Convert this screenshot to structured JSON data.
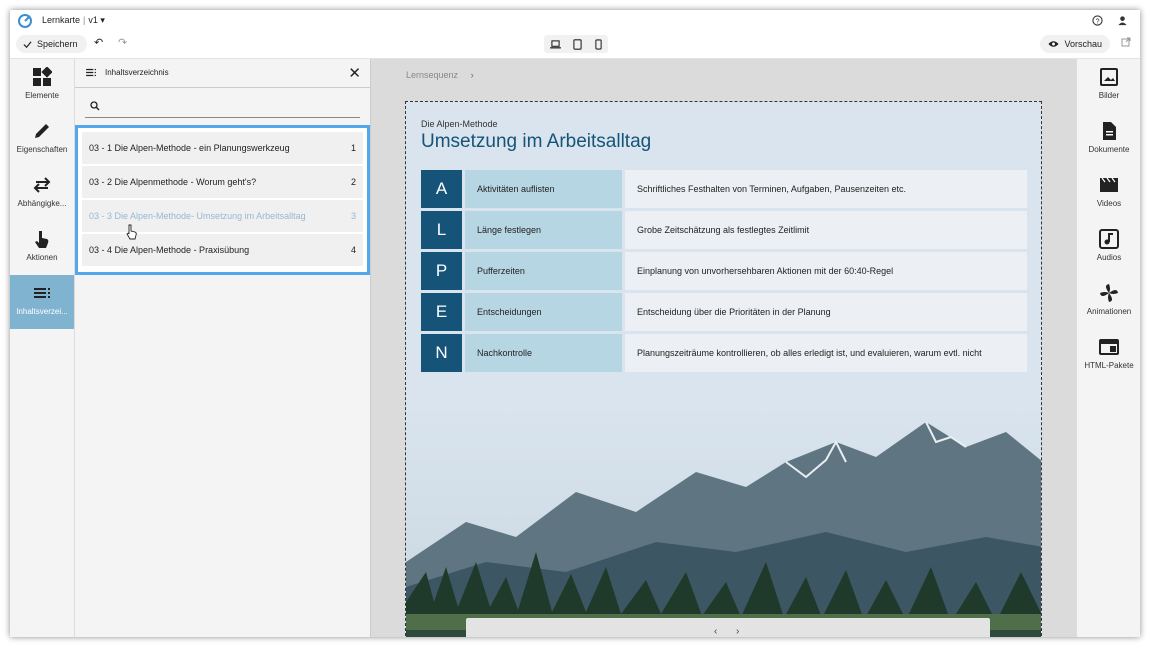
{
  "app": {
    "title": "Lernkarte",
    "version": "v1 ▾"
  },
  "toolbar": {
    "save_label": "Speichern",
    "preview_label": "Vorschau"
  },
  "left_rail": {
    "items": [
      {
        "label": "Elemente",
        "icon": "elements-icon"
      },
      {
        "label": "Eigenschaften",
        "icon": "pencil-icon"
      },
      {
        "label": "Abhängigke...",
        "icon": "swap-arrows-icon"
      },
      {
        "label": "Aktionen",
        "icon": "touch-hand-icon"
      },
      {
        "label": "Inhaltsverzei...",
        "icon": "toc-icon",
        "active": true
      }
    ]
  },
  "toc": {
    "title": "Inhaltsverzeichnis",
    "search_placeholder": "",
    "items": [
      {
        "label": "03 - 1 Die Alpen-Methode - ein Planungswerkzeug",
        "num": "1"
      },
      {
        "label": "03 - 2 Die Alpenmethode - Worum geht's?",
        "num": "2"
      },
      {
        "label": "03 - 3 Die Alpen-Methode- Umsetzung im Arbeitsalltag",
        "num": "3"
      },
      {
        "label": "03 - 4 Die Alpen-Methode - Praxisübung",
        "num": "4"
      }
    ]
  },
  "canvas": {
    "breadcrumb": "Lernsequenz"
  },
  "page": {
    "subtitle": "Die Alpen-Methode",
    "title": "Umsetzung im Arbeitsalltag",
    "rows": [
      {
        "letter": "A",
        "label": "Aktivitäten auflisten",
        "desc": "Schriftliches Festhalten von Terminen, Aufgaben, Pausenzeiten etc."
      },
      {
        "letter": "L",
        "label": "Länge festlegen",
        "desc": "Grobe Zeitschätzung als festlegtes Zeitlimit"
      },
      {
        "letter": "P",
        "label": "Pufferzeiten",
        "desc": "Einplanung von unvorhersehbaren Aktionen mit der 60:40-Regel"
      },
      {
        "letter": "E",
        "label": "Entscheidungen",
        "desc": "Entscheidung über die Prioritäten in der Planung"
      },
      {
        "letter": "N",
        "label": "Nachkontrolle",
        "desc": "Planungszeiträume kontrollieren, ob alles erledigt ist, und evaluieren, warum evtl. nicht"
      }
    ]
  },
  "right_rail": {
    "items": [
      {
        "label": "Bilder",
        "icon": "image-icon"
      },
      {
        "label": "Dokumente",
        "icon": "document-icon"
      },
      {
        "label": "Videos",
        "icon": "video-icon"
      },
      {
        "label": "Audios",
        "icon": "audio-icon"
      },
      {
        "label": "Animationen",
        "icon": "pinwheel-icon"
      },
      {
        "label": "HTML-Pakete",
        "icon": "html-package-icon"
      }
    ]
  },
  "colors": {
    "accent": "#155478",
    "label_bg": "#b7d6e4",
    "toc_highlight": "#55a7ec",
    "rail_active": "#7fb3cf"
  }
}
